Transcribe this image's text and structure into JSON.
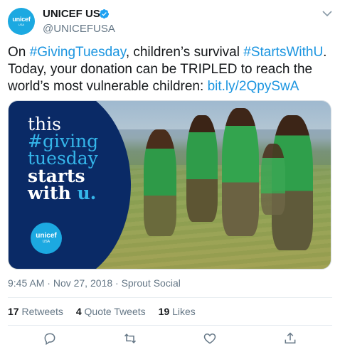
{
  "tweet": {
    "author": {
      "display_name": "UNICEF USA",
      "handle": "@UNICEFUSA",
      "avatar_logo_text": "unicef",
      "avatar_sub_text": "USA",
      "verified": true
    },
    "text": {
      "part1": "On ",
      "hashtag1": "#GivingTuesday",
      "part2": ", children’s survival ",
      "hashtag2": "#StartsWithU",
      "part3": ". Today, your donation can be TRIPLED to reach the world’s most vulnerable children: ",
      "link": "bit.ly/2QpySwA"
    },
    "media": {
      "line1": "this",
      "line2": "#giving",
      "line3": "tuesday",
      "line4": "starts",
      "line5_a": "with ",
      "line5_b": "u.",
      "logo_text": "unicef",
      "logo_sub": "USA"
    },
    "meta": {
      "time": "9:45 AM",
      "date": "Nov 27, 2018",
      "source": "Sprout Social",
      "separator": "·"
    },
    "stats": {
      "retweets_count": "17",
      "retweets_label": "Retweets",
      "quotes_count": "4",
      "quotes_label": "Quote Tweets",
      "likes_count": "19",
      "likes_label": "Likes"
    },
    "actions": [
      {
        "name": "reply",
        "icon": "reply-icon"
      },
      {
        "name": "retweet",
        "icon": "retweet-icon"
      },
      {
        "name": "like",
        "icon": "heart-icon"
      },
      {
        "name": "share",
        "icon": "share-icon"
      }
    ]
  },
  "colors": {
    "link": "#1b95e0",
    "text": "#14171a",
    "secondary": "#657786",
    "unicef_blue": "#1ca9e1",
    "panel_navy": "#0a2a66"
  }
}
